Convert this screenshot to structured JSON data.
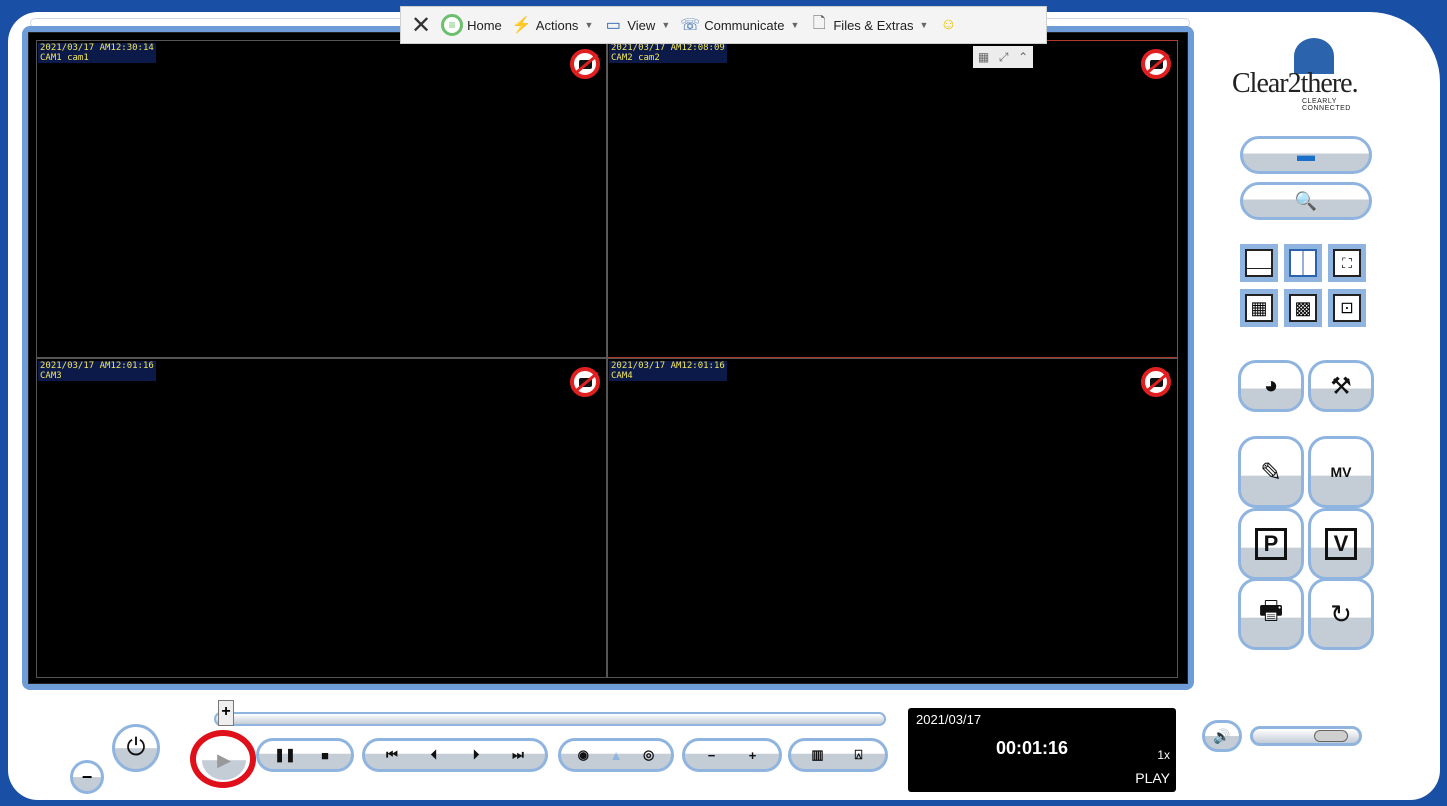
{
  "toolbar": {
    "home_label": "Home",
    "actions_label": "Actions",
    "view_label": "View",
    "communicate_label": "Communicate",
    "files_label": "Files & Extras"
  },
  "cameras": [
    {
      "timestamp": "2021/03/17 AM12:30:14",
      "name": "CAM1 cam1"
    },
    {
      "timestamp": "2021/03/17 AM12:08:09",
      "name": "CAM2 cam2"
    },
    {
      "timestamp": "2021/03/17 AM12:01:16",
      "name": "CAM3"
    },
    {
      "timestamp": "2021/03/17 AM12:01:16",
      "name": "CAM4"
    }
  ],
  "logo": {
    "brand": "Clear2there.",
    "tagline": "CLEARLY CONNECTED"
  },
  "status": {
    "date": "2021/03/17",
    "time": "00:01:16",
    "speed": "1x",
    "mode": "PLAY"
  },
  "buttons": {
    "mv_label": "MV",
    "p_label": "P",
    "v_label": "V"
  },
  "volume": {
    "level": 0.85
  },
  "colors": {
    "accent": "#1a4fa6",
    "highlight": "#e0101a"
  }
}
